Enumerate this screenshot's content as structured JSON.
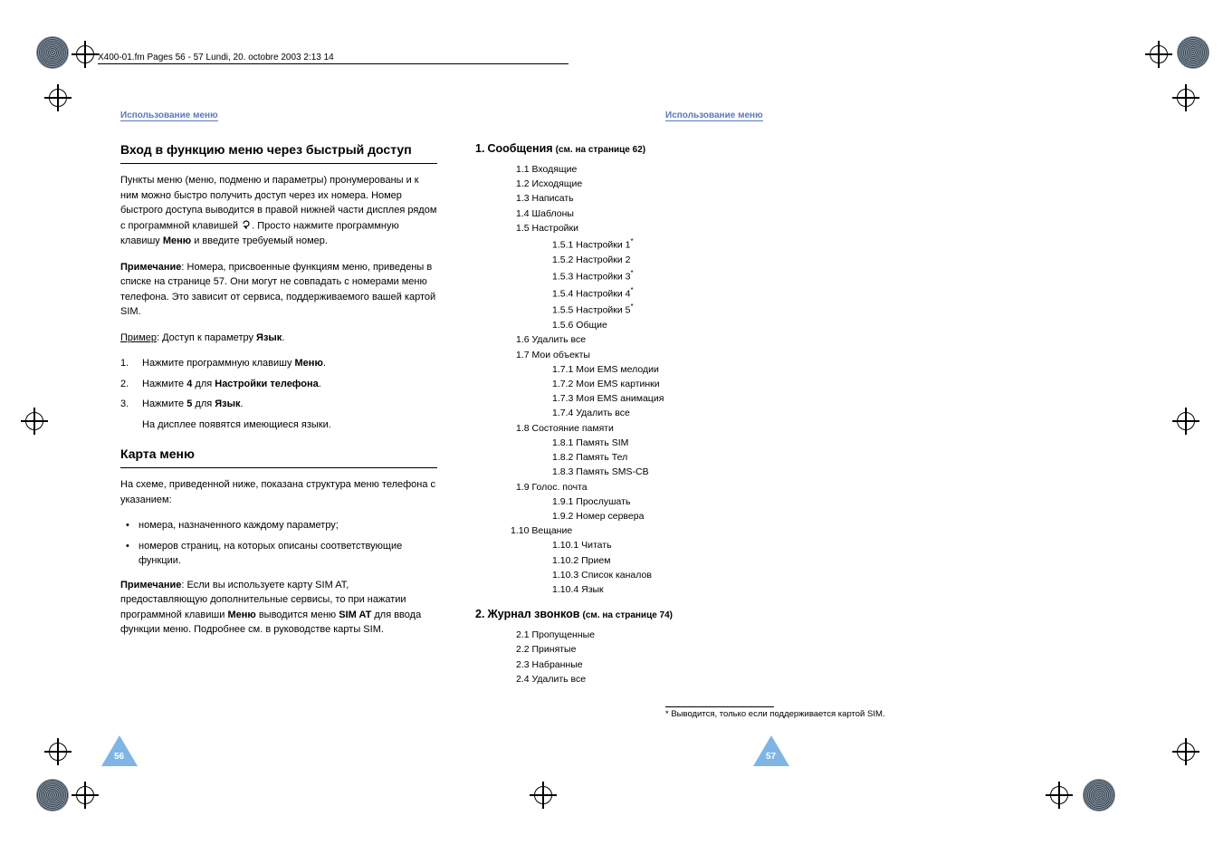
{
  "page_info_bar": "X400-01.fm  Pages 56 - 57  Lundi, 20. octobre 2003  2:13 14",
  "header": {
    "left": "Использование меню",
    "right": "Использование меню"
  },
  "left_page": {
    "title1": "Вход в функцию меню через быстрый доступ",
    "para1_a": "Пункты меню (меню, подменю и параметры) пронумерованы и к ним можно быстро получить доступ через их номера. Номер быстрого доступа выводится в правой нижней части дисплея рядом с программной клавишей ",
    "para1_b": ". Просто нажмите программную клавишу ",
    "para1_menu": "Меню",
    "para1_c": " и введите требуемый номер.",
    "note1_label": "Примечание",
    "note1_text": ": Номера, присвоенные функциям меню, приведены в списке на странице 57. Они могут не совпадать с номерами меню телефона. Это зависит от сервиса, поддерживаемого вашей картой SIM.",
    "example_label": "Пример",
    "example_rest": ": Доступ к параметру ",
    "example_bold": "Язык",
    "example_dot": ".",
    "step1_a": "Нажмите программную клавишу ",
    "step1_b": "Меню",
    "step1_dot": ".",
    "step2_a": "Нажмите ",
    "step2_b": "4",
    "step2_c": " для ",
    "step2_d": "Настройки телефона",
    "step2_dot": ".",
    "step3_a": "Нажмите ",
    "step3_b": "5",
    "step3_c": " для ",
    "step3_d": "Язык",
    "step3_dot": ".",
    "step3_result": "На дисплее появятся имеющиеся языки.",
    "title2": "Карта меню",
    "para2": "На схеме, приведенной ниже, показана структура меню телефона с указанием:",
    "bullet1": "номера, назначенного каждому параметру;",
    "bullet2": "номеров страниц, на которых описаны соответствующие функции.",
    "note2_label": "Примечание",
    "note2_text_a": ": Если вы используете карту SIM AT, предоставляющую дополнительные сервисы, то при нажатии программной клавиши ",
    "note2_text_menu": "Меню",
    "note2_text_b": " выводится меню ",
    "note2_text_sim": "SIM AT",
    "note2_text_c": " для ввода функции меню. Подробнее см. в руководстве карты SIM."
  },
  "right_page": {
    "s1_num": "1.",
    "s1_title": "Сообщения",
    "s1_ref": "(см. на странице 62)",
    "s1_items": [
      "1.1  Входящие",
      "1.2  Исходящие",
      "1.3  Написать",
      "1.4  Шаблоны",
      "1.5  Настройки"
    ],
    "s1_5_sub": [
      {
        "t": "1.5.1  Настройки 1",
        "s": "*"
      },
      {
        "t": "1.5.2  Настройки 2",
        "s": ""
      },
      {
        "t": "1.5.3  Настройки 3",
        "s": "*"
      },
      {
        "t": "1.5.4  Настройки 4",
        "s": "*"
      },
      {
        "t": "1.5.5  Настройки 5",
        "s": "*"
      },
      {
        "t": "1.5.6  Общие",
        "s": ""
      }
    ],
    "s1_after5": [
      "1.6  Удалить все",
      "1.7  Мои объекты"
    ],
    "s1_7_sub": [
      "1.7.1  Мои EMS мелодии",
      "1.7.2  Мои EMS картинки",
      "1.7.3  Моя EMS анимация",
      "1.7.4  Удалить все"
    ],
    "s1_after7": [
      "1.8  Состояние памяти"
    ],
    "s1_8_sub": [
      "1.8.1  Память SIM",
      "1.8.2  Память Тел",
      "1.8.3  Память SMS-CB"
    ],
    "s1_after8": [
      "1.9  Голос. почта"
    ],
    "s1_9_sub": [
      "1.9.1  Прослушать",
      "1.9.2  Номер сервера"
    ],
    "s1_after9": [
      "1.10  Вещание"
    ],
    "s1_10_sub": [
      "1.10.1  Читать",
      "1.10.2  Прием",
      "1.10.3  Список каналов",
      "1.10.4  Язык"
    ],
    "s2_num": "2.",
    "s2_title": "Журнал звонков",
    "s2_ref": "(см. на странице 74)",
    "s2_items": [
      "2.1  Пропущенные",
      "2.2  Принятые",
      "2.3  Набранные",
      "2.4  Удалить все"
    ]
  },
  "footnote": "* Выводится, только если поддерживается картой SIM.",
  "page_numbers": {
    "left": "56",
    "right": "57"
  }
}
